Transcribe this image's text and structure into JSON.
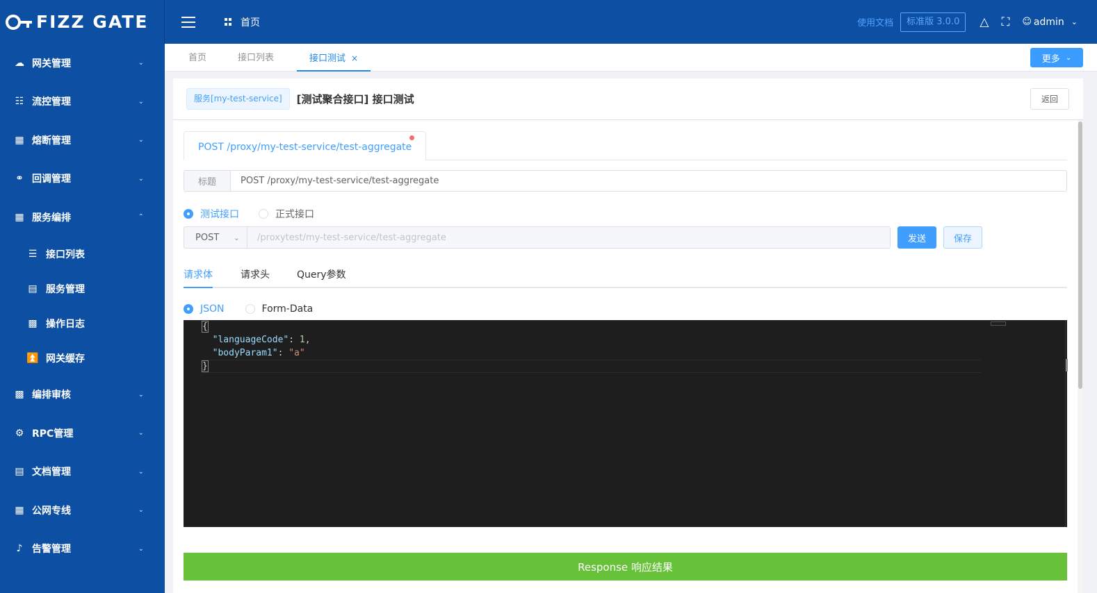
{
  "app": {
    "logo_text": "FIZZ GATE",
    "breadcrumb_home": "首页",
    "doc_link": "使用文档",
    "version": "标准版 3.0.0",
    "user": "admin"
  },
  "sidebar": {
    "items": [
      {
        "label": "网关管理",
        "icon": "cloud-icon"
      },
      {
        "label": "流控管理",
        "icon": "sitemap-icon"
      },
      {
        "label": "熔断管理",
        "icon": "calendar-icon"
      },
      {
        "label": "回调管理",
        "icon": "link-icon"
      },
      {
        "label": "服务编排",
        "icon": "apps-icon"
      },
      {
        "label": "编排审核",
        "icon": "audit-icon"
      },
      {
        "label": "RPC管理",
        "icon": "gear-icon"
      },
      {
        "label": "文档管理",
        "icon": "document-icon"
      },
      {
        "label": "公网专线",
        "icon": "network-icon"
      },
      {
        "label": "告警管理",
        "icon": "bell-icon"
      }
    ],
    "sub_items": [
      {
        "label": "接口列表",
        "icon": "list-icon"
      },
      {
        "label": "服务管理",
        "icon": "server-icon"
      },
      {
        "label": "操作日志",
        "icon": "log-icon"
      },
      {
        "label": "网关缓存",
        "icon": "cache-icon"
      }
    ]
  },
  "tabs": [
    {
      "label": "首页"
    },
    {
      "label": "接口列表"
    },
    {
      "label": "接口测试",
      "close": "×"
    }
  ],
  "more_button": "更多",
  "panel": {
    "service_tag": "服务[my-test-service]",
    "title": "[测试聚合接口] 接口测试",
    "back_button": "返回",
    "api_tab": "POST /proxy/my-test-service/test-aggregate",
    "title_label": "标题",
    "title_value": "POST /proxy/my-test-service/test-aggregate",
    "env_options": [
      "测试接口",
      "正式接口"
    ],
    "method": "POST",
    "url_placeholder": "/proxytest/my-test-service/test-aggregate",
    "send_button": "发送",
    "save_button": "保存",
    "sub_tabs": [
      "请求体",
      "请求头",
      "Query参数"
    ],
    "body_types": [
      "JSON",
      "Form-Data"
    ],
    "editor": {
      "open_brace": "{",
      "key1": "\"languageCode\"",
      "val1": "1",
      "key2": "\"bodyParam1\"",
      "val2": "\"a\"",
      "close_brace": "}"
    },
    "response_label": "Response 响应结果"
  },
  "colors": {
    "primary": "#0d4fa3",
    "accent": "#409eff",
    "success": "#67c23a"
  }
}
